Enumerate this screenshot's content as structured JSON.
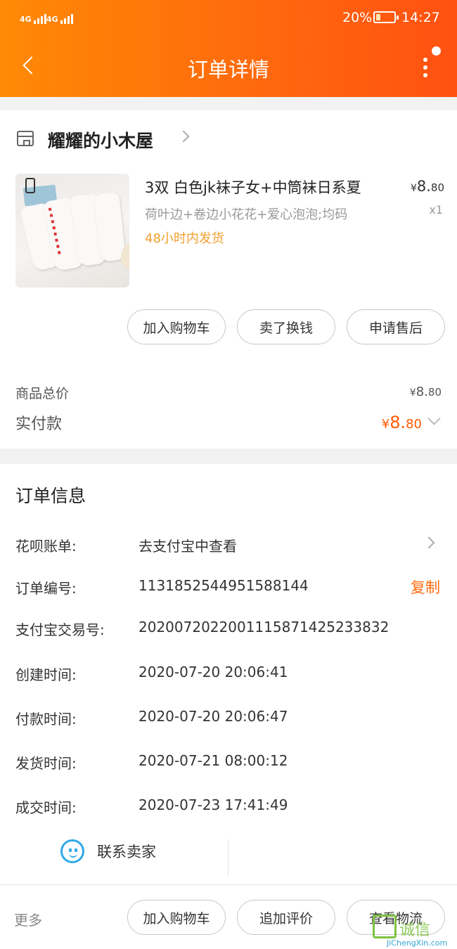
{
  "status_bar": {
    "signal_1": "4G",
    "signal_2": "4G",
    "battery": "20%",
    "time": "14:27"
  },
  "header": {
    "title": "订单详情",
    "back_icon": "chevron-left-icon",
    "menu_icon": "more-vertical-icon"
  },
  "shop": {
    "name": "耀耀的小木屋",
    "icon": "store-icon"
  },
  "item": {
    "title": "3双 白色jk袜子女+中筒袜日系夏",
    "spec": "荷叶边+卷边小花花+爱心泡泡;均码",
    "shipping": "48小时内发货",
    "price_symbol": "¥",
    "price_int": "8.",
    "price_dec": "80",
    "quantity": "x1"
  },
  "item_actions": {
    "add_cart": "加入购物车",
    "resell": "卖了换钱",
    "after_sale": "申请售后"
  },
  "totals": {
    "goods_total_label": "商品总价",
    "goods_total_symbol": "¥",
    "goods_total_int": "8.",
    "goods_total_dec": "80",
    "paid_label": "实付款",
    "paid_symbol": "¥",
    "paid_int": "8.",
    "paid_dec": "80"
  },
  "order_info": {
    "title": "订单信息",
    "rows": [
      {
        "label": "花呗账单:",
        "value": "去支付宝中查看"
      },
      {
        "label": "订单编号:",
        "value": "1131852544951588144"
      },
      {
        "label": "支付宝交易号:",
        "value": "2020072022001115871425233832"
      },
      {
        "label": "创建时间:",
        "value": "2020-07-20 20:06:41"
      },
      {
        "label": "付款时间:",
        "value": "2020-07-20 20:06:47"
      },
      {
        "label": "发货时间:",
        "value": "2020-07-21 08:00:12"
      },
      {
        "label": "成交时间:",
        "value": "2020-07-23 17:41:49"
      }
    ],
    "copy_label": "复制",
    "contact_label": "联系卖家"
  },
  "bottom_bar": {
    "more": "更多",
    "add_cart": "加入购物车",
    "add_review": "追加评价",
    "view_logistics": "查看物流"
  },
  "watermark": {
    "text": "诚信",
    "sub": "JiChengXin.com"
  },
  "colors": {
    "accent": "#ff6a0d",
    "shipping": "#f0a030",
    "chat": "#2fa9e8"
  }
}
